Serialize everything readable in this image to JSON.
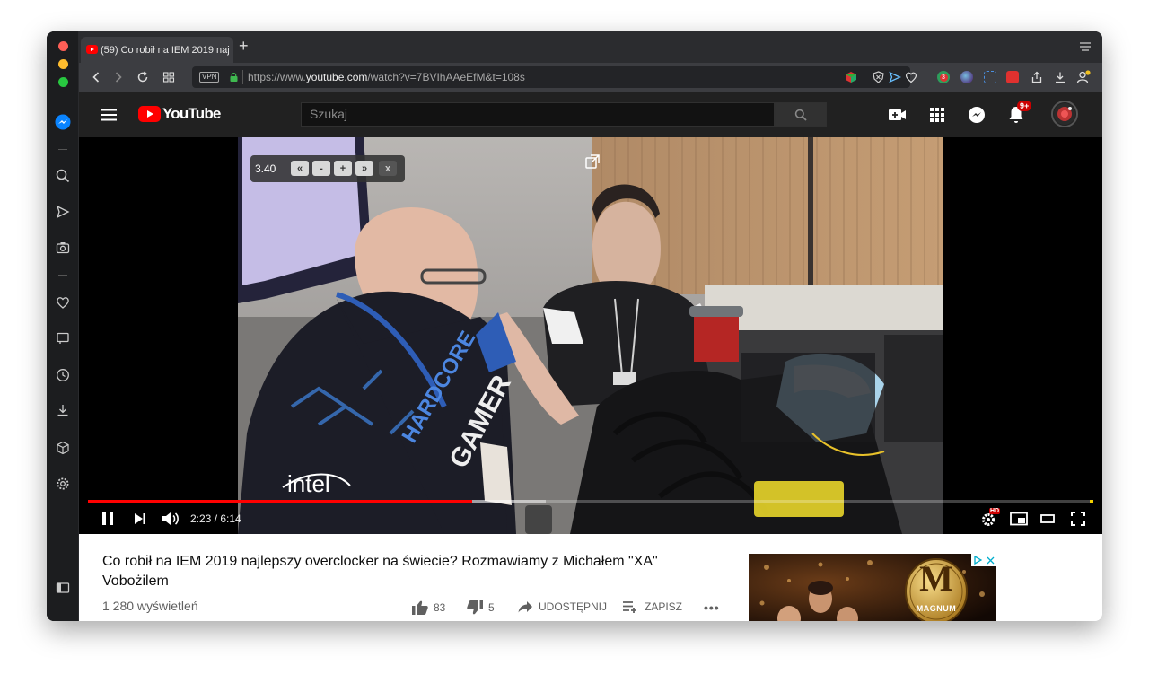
{
  "browser": {
    "tab_title": "(59) Co robił na IEM 2019 naj",
    "vpn_label": "VPN",
    "url_prefix": "https://www.",
    "url_host": "youtube.com",
    "url_path": "/watch?v=7BVIhAAeEfM&t=108s",
    "ext_count_badge": "3"
  },
  "youtube": {
    "logo_text": "YouTube",
    "search_placeholder": "Szukaj",
    "notifications_badge": "9+"
  },
  "player": {
    "speed_value": "3.40",
    "speed_buttons": [
      "«",
      "-",
      "+",
      "»",
      "x"
    ],
    "time_current": "2:23",
    "time_separator": " / ",
    "time_total": "6:14",
    "progress_fraction": 0.382,
    "buffer_fraction": 0.455,
    "hd_badge": "HD",
    "shirt_text_1": "HARDCORE",
    "shirt_text_2": "GAMER",
    "sponsor_text": "intel"
  },
  "video_info": {
    "title": "Co robił na IEM 2019 najlepszy overclocker na świecie? Rozmawiamy z Michałem \"XA\" Vobożilem",
    "views": "1 280 wyświetleń",
    "likes": "83",
    "dislikes": "5",
    "share_label": "UDOSTĘPNIJ",
    "save_label": "ZAPISZ",
    "more_label": "•••"
  },
  "ad": {
    "brand_letter": "M",
    "brand_name": "MAGNUM"
  },
  "colors": {
    "yt_red": "#ff0000",
    "header_bg": "#212121",
    "browser_bg": "#202124"
  }
}
